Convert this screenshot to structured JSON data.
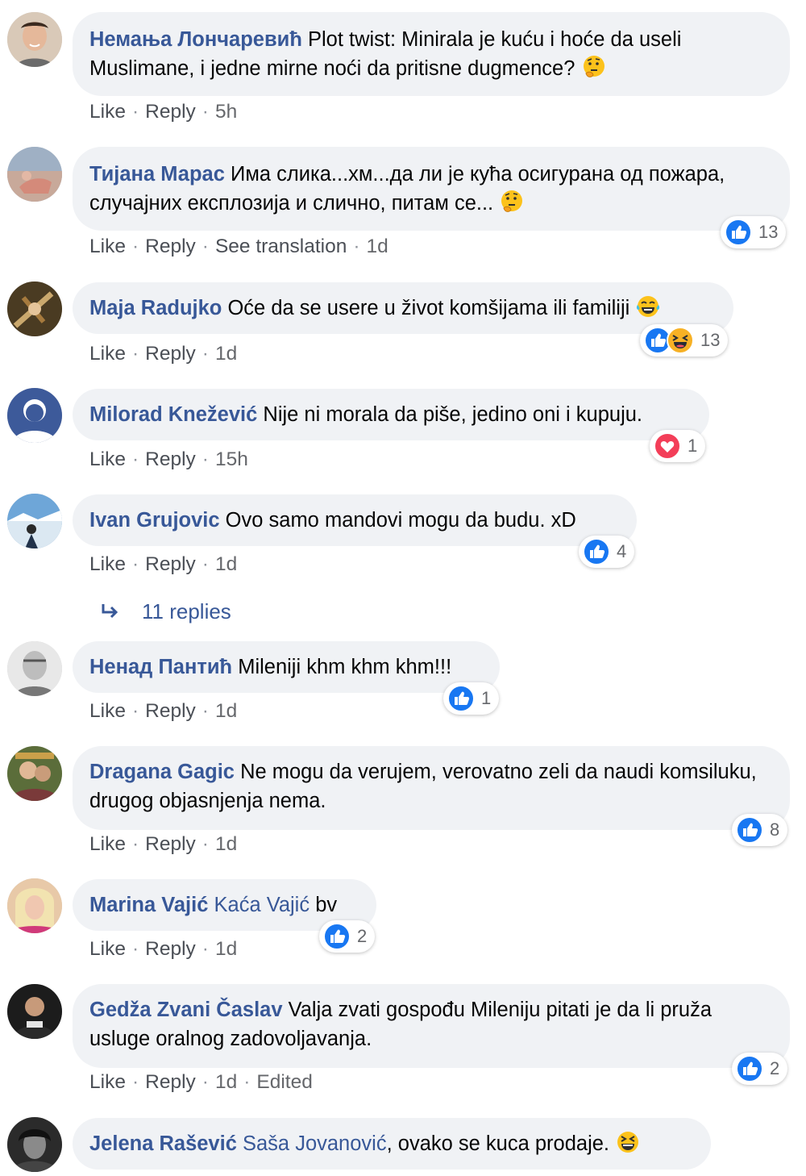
{
  "comments": [
    {
      "author": "Немања Лончаревић",
      "text": "Plot twist: Minirala je kuću i hoće da useli Muslimane, i jedne mirne noći da pritisne dugmence?",
      "emoji": "thinking-face",
      "actions": [
        "Like",
        "Reply",
        "5h"
      ],
      "reaction_count": ""
    },
    {
      "author": "Тијана Марас",
      "text": "Има слика...хм...да ли је кућа осигурана од пожара, случајних експлозија и слично, питам се...",
      "emoji": "thinking-face",
      "actions": [
        "Like",
        "Reply",
        "See translation",
        "1d"
      ],
      "reaction_count": "13"
    },
    {
      "author": "Maja Radujko",
      "text": "Oće da se usere u život komšijama ili familiji",
      "emoji": "tears-of-joy-face",
      "actions": [
        "Like",
        "Reply",
        "1d"
      ],
      "reaction_count": "13"
    },
    {
      "author": "Milorad Knežević",
      "text": "Nije ni morala da piše, jedino oni i kupuju.",
      "actions": [
        "Like",
        "Reply",
        "15h"
      ],
      "reaction_count": "1"
    },
    {
      "author": "Ivan Grujovic",
      "text": "Ovo samo mandovi mogu da budu. xD",
      "actions": [
        "Like",
        "Reply",
        "1d"
      ],
      "reaction_count": "4"
    },
    {
      "author": "Ненад Пантић",
      "text": "Mileniji khm khm khm!!!",
      "actions": [
        "Like",
        "Reply",
        "1d"
      ],
      "reaction_count": "1"
    },
    {
      "author": "Dragana Gagic",
      "text": "Ne mogu da verujem, verovatno zeli da naudi komsiluku, drugog objasnjenja nema.",
      "actions": [
        "Like",
        "Reply",
        "1d"
      ],
      "reaction_count": "8"
    },
    {
      "author": "Marina Vajić",
      "tag": "Kaća Vajić",
      "text": "bv",
      "actions": [
        "Like",
        "Reply",
        "1d"
      ],
      "reaction_count": "2"
    },
    {
      "author": "Gedža Zvani Časlav",
      "text": "Valja zvati gospođu Mileniju pitati je da li pruža usluge oralnog zadovoljavanja.",
      "actions": [
        "Like",
        "Reply",
        "1d",
        "Edited"
      ],
      "reaction_count": "2"
    },
    {
      "author": "Jelena Rašević",
      "tag": "Saša Jovanović",
      "text": ", ovako se kuca prodaje.",
      "emoji": "grinning-squinting-face",
      "actions": [],
      "reaction_count": ""
    }
  ],
  "replies_link": "11 replies",
  "colors": {
    "author": "#385898",
    "bubble": "#f0f2f5",
    "meta": "#65676b",
    "like_blue": "#1877f2",
    "love_red": "#f33e58"
  }
}
